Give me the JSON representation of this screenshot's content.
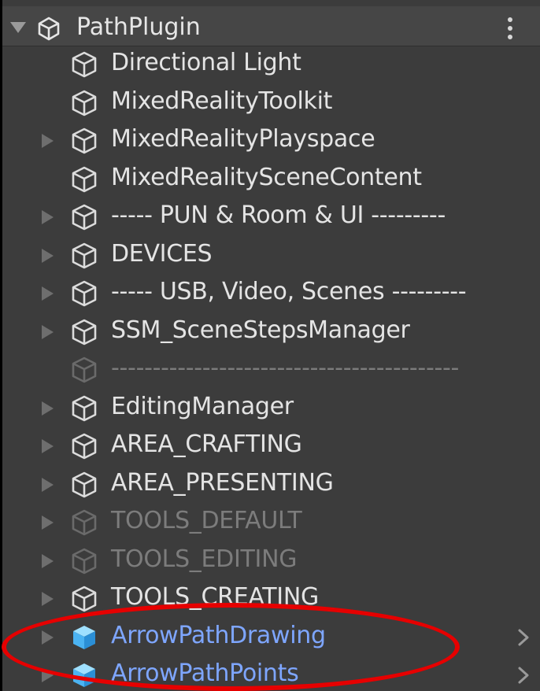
{
  "scene": {
    "title": "PathPlugin",
    "logo": "unity-logo-icon",
    "menu_icon": "kebab-menu-icon"
  },
  "hierarchy": [
    {
      "name": "Directional Light",
      "has_children": false,
      "state": "normal"
    },
    {
      "name": "MixedRealityToolkit",
      "has_children": false,
      "state": "normal"
    },
    {
      "name": "MixedRealityPlayspace",
      "has_children": true,
      "state": "normal"
    },
    {
      "name": "MixedRealitySceneContent",
      "has_children": false,
      "state": "normal"
    },
    {
      "name": "----- PUN & Room & UI ---------",
      "has_children": true,
      "state": "normal"
    },
    {
      "name": "DEVICES",
      "has_children": true,
      "state": "normal"
    },
    {
      "name": "----- USB, Video, Scenes ---------",
      "has_children": true,
      "state": "normal"
    },
    {
      "name": "SSM_SceneStepsManager",
      "has_children": true,
      "state": "normal"
    },
    {
      "name": "------------------------------------------",
      "has_children": false,
      "state": "inactive"
    },
    {
      "name": "EditingManager",
      "has_children": true,
      "state": "normal"
    },
    {
      "name": "AREA_CRAFTING",
      "has_children": true,
      "state": "normal"
    },
    {
      "name": "AREA_PRESENTING",
      "has_children": true,
      "state": "normal"
    },
    {
      "name": "TOOLS_DEFAULT",
      "has_children": true,
      "state": "inactive"
    },
    {
      "name": "TOOLS_EDITING",
      "has_children": true,
      "state": "inactive"
    },
    {
      "name": "TOOLS_CREATING",
      "has_children": true,
      "state": "normal"
    },
    {
      "name": "ArrowPathDrawing",
      "has_children": true,
      "state": "prefab"
    },
    {
      "name": "ArrowPathPoints",
      "has_children": true,
      "state": "prefab"
    }
  ],
  "colors": {
    "panel_bg": "#3c3c3c",
    "text": "#e4e4e4",
    "inactive_text": "#7c7c7c",
    "prefab_text": "#7ea6ff",
    "prefab_icon": "#5fc2ff",
    "annotation": "#e60000"
  }
}
